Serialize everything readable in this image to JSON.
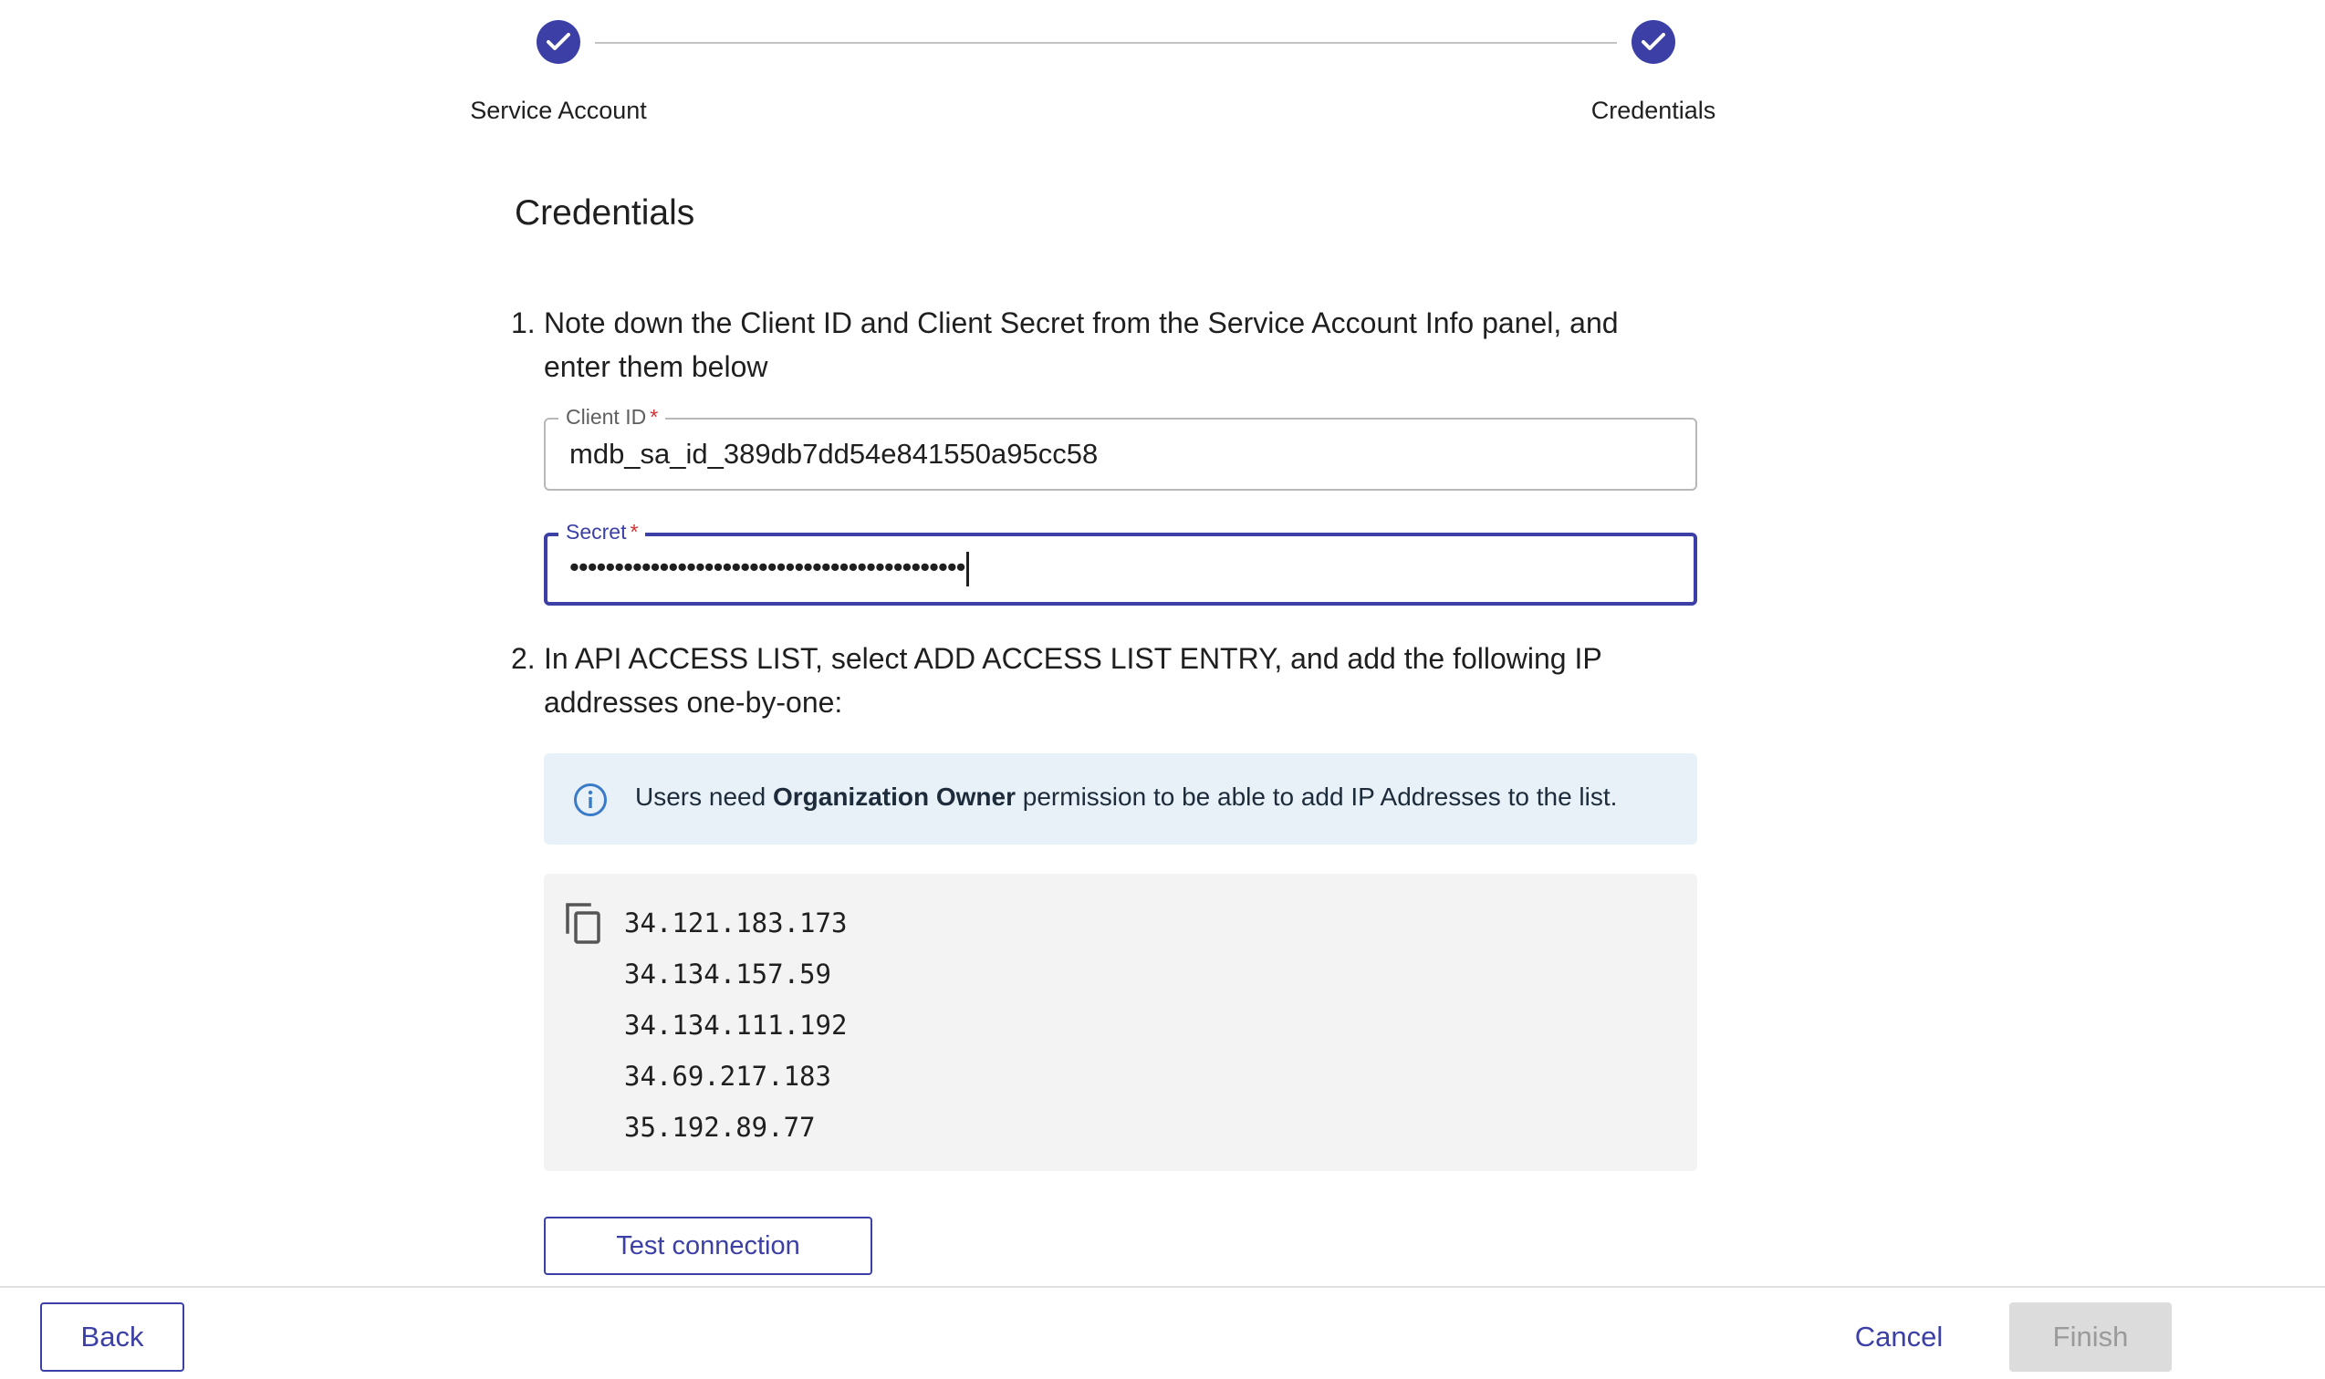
{
  "stepper": {
    "steps": [
      {
        "label": "Service Account",
        "status": "completed",
        "icon": "check-icon"
      },
      {
        "label": "Credentials",
        "status": "completed",
        "icon": "check-icon"
      }
    ]
  },
  "section": {
    "title": "Credentials"
  },
  "instructions": {
    "step1": {
      "number": "1.",
      "line1": "Note down the Client ID and Client Secret from the Service Account Info panel, and",
      "line2": "enter them below"
    },
    "step2": {
      "number": "2.",
      "line1": "In API ACCESS LIST, select ADD ACCESS LIST ENTRY, and add the following IP",
      "line2": "addresses one-by-one:"
    }
  },
  "form": {
    "client_id": {
      "label": "Client ID",
      "required_mark": "*",
      "value": "mdb_sa_id_389db7dd54e841550a95cc58"
    },
    "secret": {
      "label": "Secret",
      "required_mark": "*",
      "value": "••••••••••••••••••••••••••••••••••••••••••••"
    }
  },
  "info_banner": {
    "icon": "info-icon",
    "text_before": "Users need ",
    "text_bold": "Organization Owner",
    "text_after": " permission to be able to add IP Addresses to the list."
  },
  "ip_addresses": {
    "copy_icon": "copy-icon",
    "items": [
      "34.121.183.173",
      "34.134.157.59",
      "34.134.111.192",
      "34.69.217.183",
      "35.192.89.77"
    ]
  },
  "actions": {
    "test_connection": "Test connection",
    "back": "Back",
    "cancel": "Cancel",
    "finish": "Finish"
  },
  "colors": {
    "accent": "#3b3fa6",
    "required": "#d32f2f",
    "info_bg": "#e8f0f8",
    "code_bg": "#f3f3f3",
    "disabled_bg": "#dcdcdc"
  }
}
